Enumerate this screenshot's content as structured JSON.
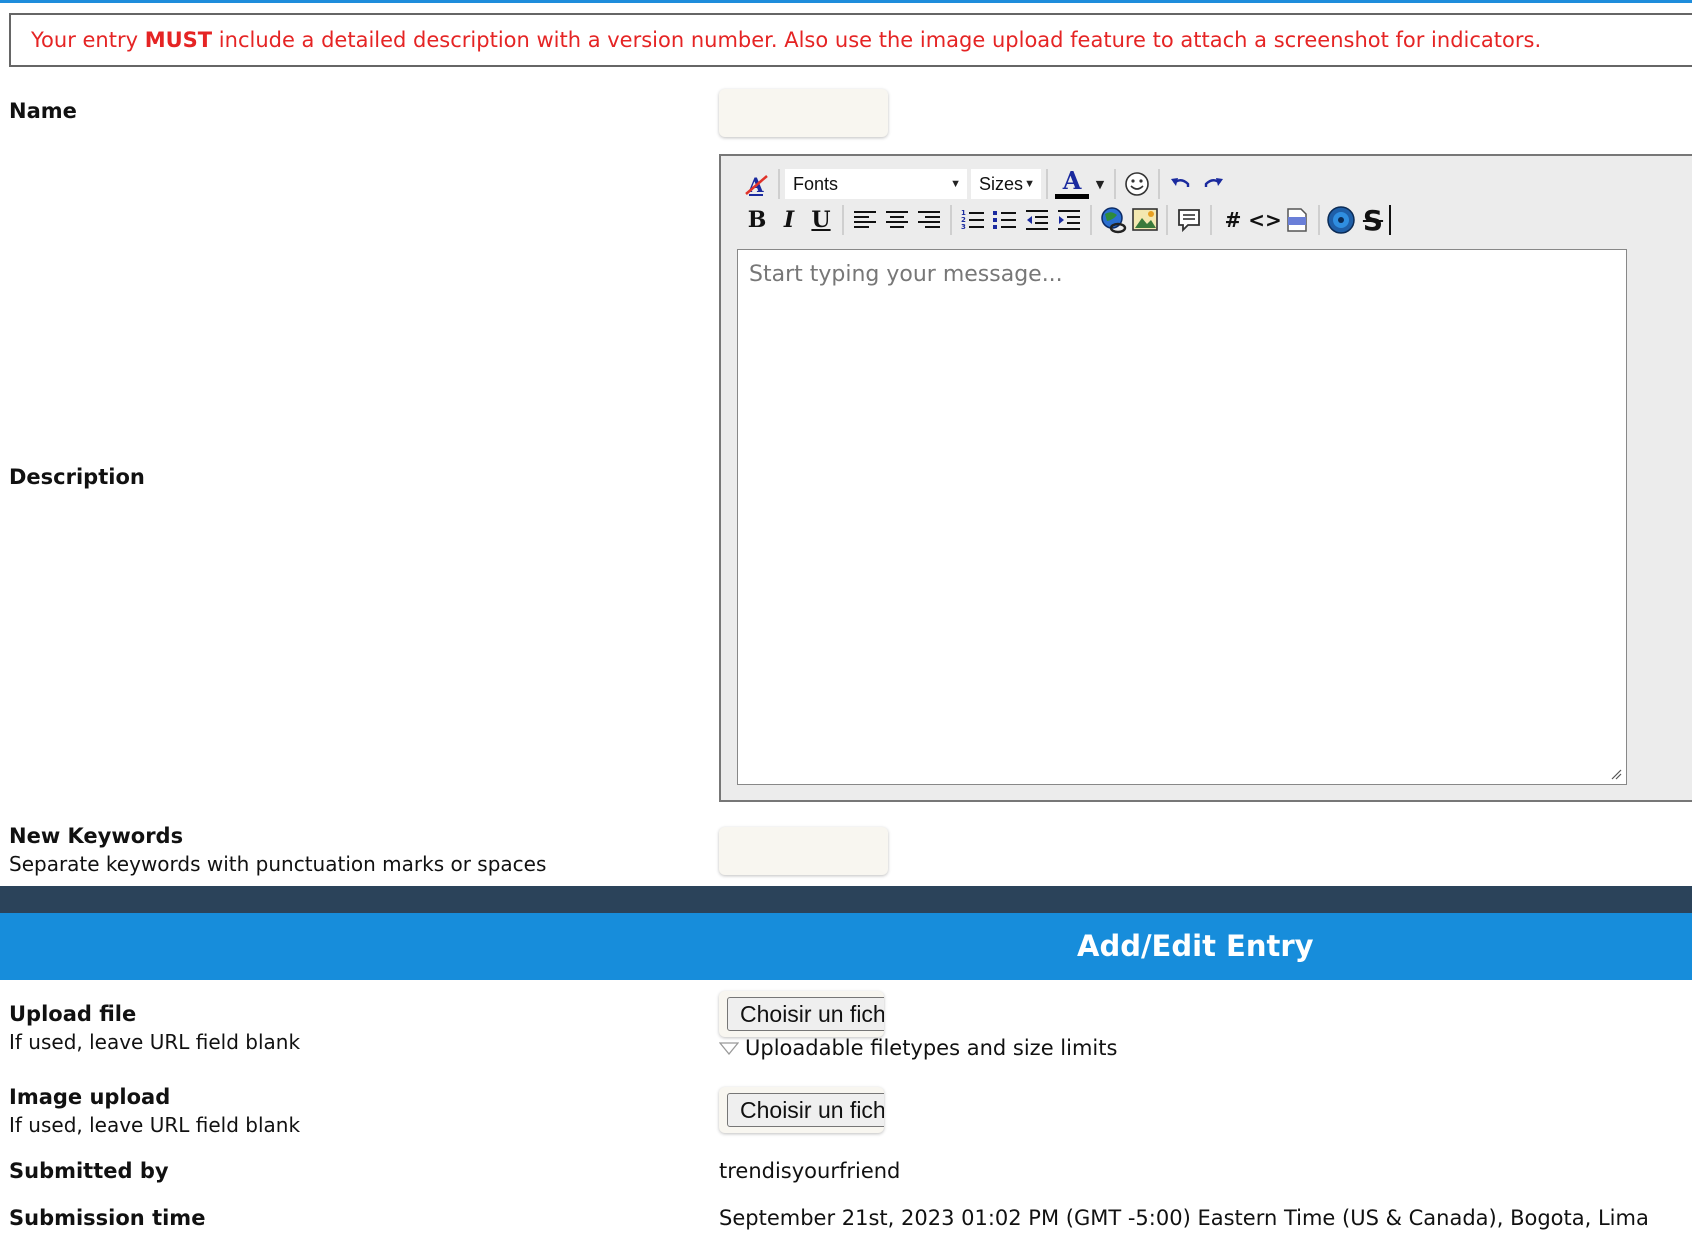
{
  "notice": {
    "pre": "Your entry ",
    "emphasis": "MUST",
    "post": " include a detailed description with a version number. Also use the image upload feature to attach a screenshot for indicators."
  },
  "fields": {
    "name_label": "Name",
    "description_label": "Description",
    "keywords_label": "New Keywords",
    "keywords_help": "Separate keywords with punctuation marks or spaces"
  },
  "editor": {
    "fonts_label": "Fonts",
    "sizes_label": "Sizes",
    "placeholder": "Start typing your message...",
    "toolbar_row1_icons": [
      "remove-format-icon",
      "fonts-select",
      "sizes-select",
      "text-color-icon",
      "color-dropdown-icon",
      "smiley-icon",
      "undo-icon",
      "redo-icon"
    ],
    "toolbar_row2_icons": [
      "bold-icon",
      "italic-icon",
      "underline-icon",
      "align-left-icon",
      "align-center-icon",
      "align-right-icon",
      "ordered-list-icon",
      "unordered-list-icon",
      "outdent-icon",
      "indent-icon",
      "insert-link-icon",
      "insert-image-icon",
      "quote-icon",
      "hashtag-icon",
      "code-icon",
      "php-icon",
      "media-icon",
      "strikethrough-icon"
    ],
    "bold_glyph": "B",
    "italic_glyph": "I",
    "underline_glyph": "U",
    "hash_glyph": "#",
    "code_glyph": "<>",
    "strike_glyph": "S",
    "color_glyph": "A"
  },
  "section": {
    "title": "Add/Edit Entry"
  },
  "upload": {
    "file_label": "Upload file",
    "file_help": "If used, leave URL field blank",
    "choose_file": "Choisir un fich",
    "filetypes_toggle": "Uploadable filetypes and size limits",
    "image_label": "Image upload",
    "image_help": "If used, leave URL field blank",
    "choose_image": "Choisir un fich"
  },
  "meta": {
    "submitted_by_label": "Submitted by",
    "submitted_by_value": "trendisyourfriend",
    "submission_time_label": "Submission time",
    "submission_time_value": "September 21st, 2023 01:02 PM (GMT -5:00) Eastern Time (US & Canada), Bogota, Lima"
  },
  "colors": {
    "accent_blue": "#178ddb",
    "dark_bar": "#2b435a",
    "notice_red": "#e52424"
  }
}
